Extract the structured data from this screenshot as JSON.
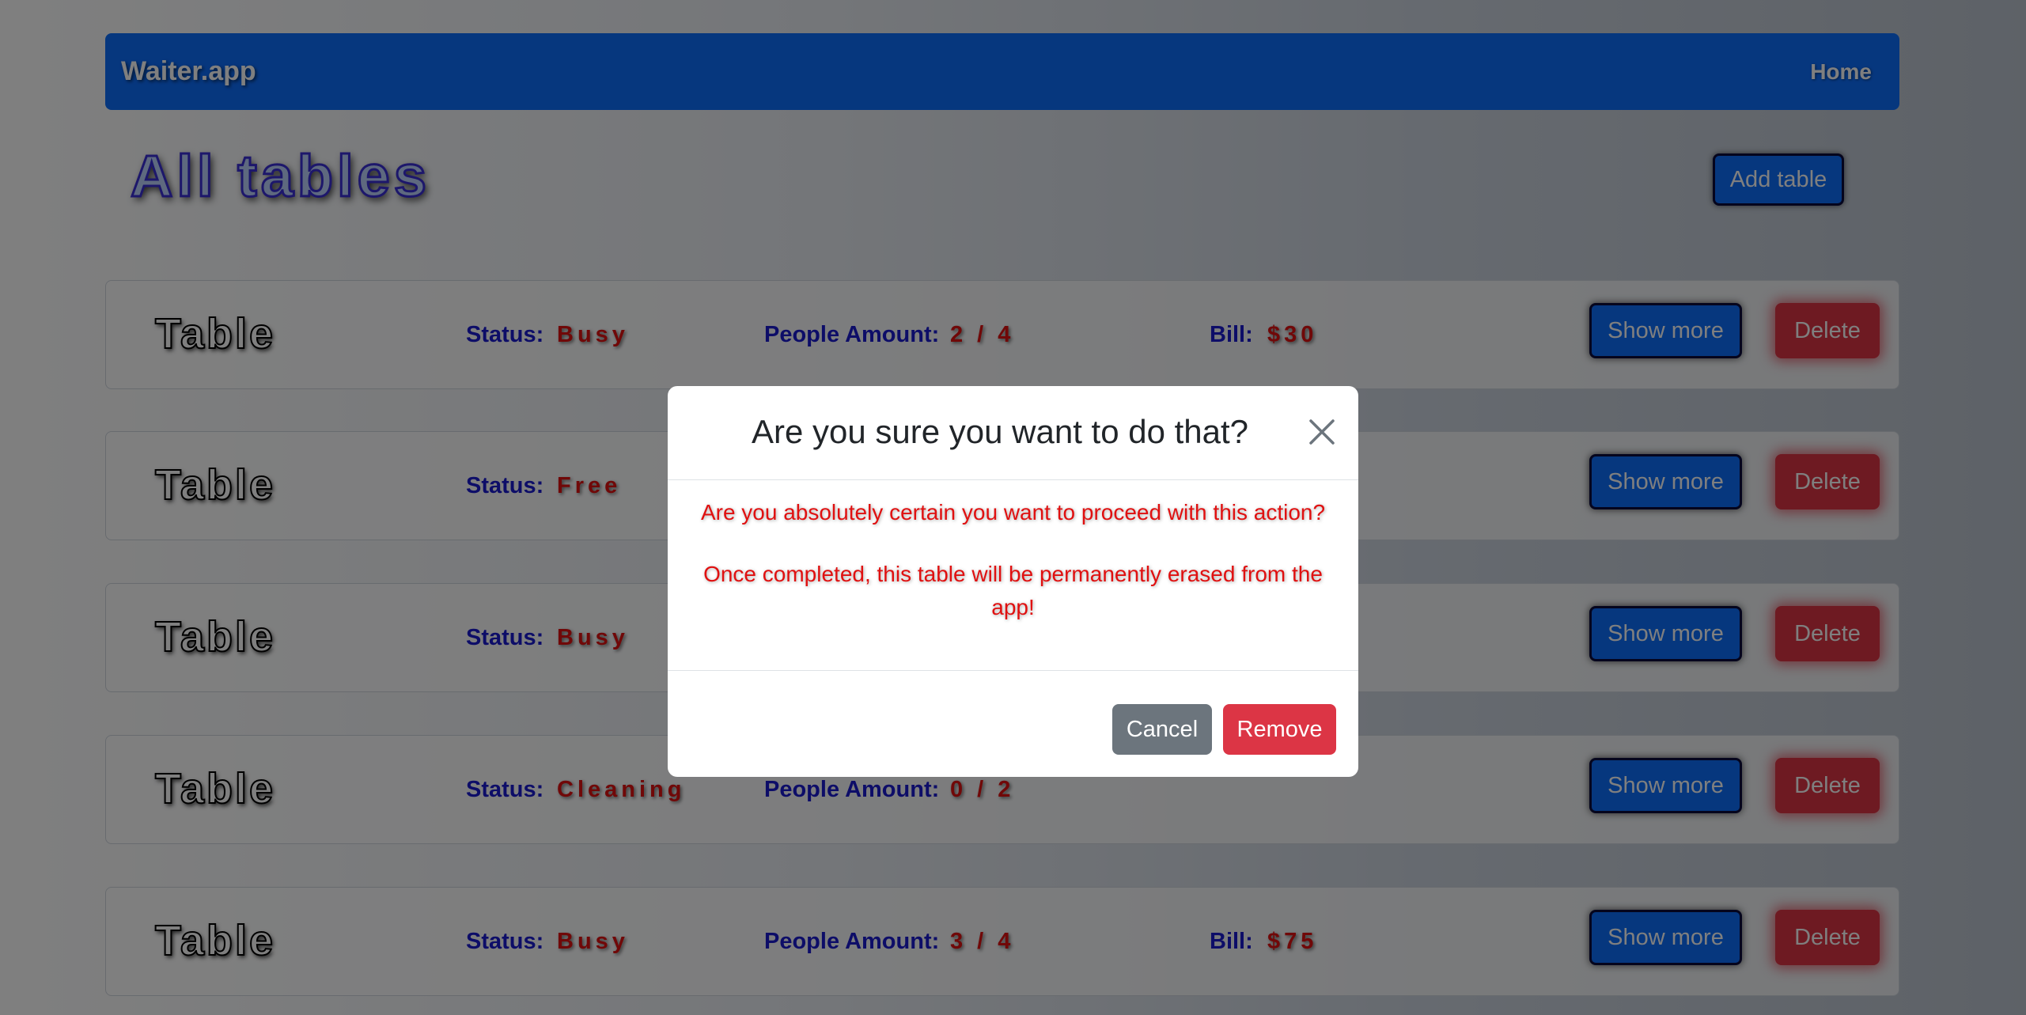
{
  "navbar": {
    "brand": "Waiter.app",
    "home_link": "Home"
  },
  "header": {
    "title": "All tables",
    "add_button": "Add table"
  },
  "rows": [
    {
      "name": "Table",
      "status_label": "Status:",
      "status": "Busy",
      "people_label": "People Amount:",
      "people": "2 / 4",
      "bill_label": "Bill:",
      "bill": "$30",
      "show_more": "Show more",
      "delete": "Delete"
    },
    {
      "name": "Table",
      "status_label": "Status:",
      "status": "Free",
      "show_more": "Show more",
      "delete": "Delete"
    },
    {
      "name": "Table",
      "status_label": "Status:",
      "status": "Busy",
      "show_more": "Show more",
      "delete": "Delete"
    },
    {
      "name": "Table",
      "status_label": "Status:",
      "status": "Cleaning",
      "people_label": "People Amount:",
      "people": "0 / 2",
      "show_more": "Show more",
      "delete": "Delete"
    },
    {
      "name": "Table",
      "status_label": "Status:",
      "status": "Busy",
      "people_label": "People Amount:",
      "people": "3 / 4",
      "bill_label": "Bill:",
      "bill": "$75",
      "show_more": "Show more",
      "delete": "Delete"
    }
  ],
  "modal": {
    "title": "Are you sure you want to do that?",
    "message_1": "Are you absolutely certain you want to proceed with this action?",
    "message_2": "Once completed, this table will be permanently erased from the app!",
    "cancel_button": "Cancel",
    "remove_button": "Remove",
    "close_icon": "close-icon"
  },
  "colors": {
    "primary": "#0d6efd",
    "danger": "#dc3545",
    "secondary": "#6c757d",
    "label": "#1b1bd0",
    "value": "#e01010"
  }
}
